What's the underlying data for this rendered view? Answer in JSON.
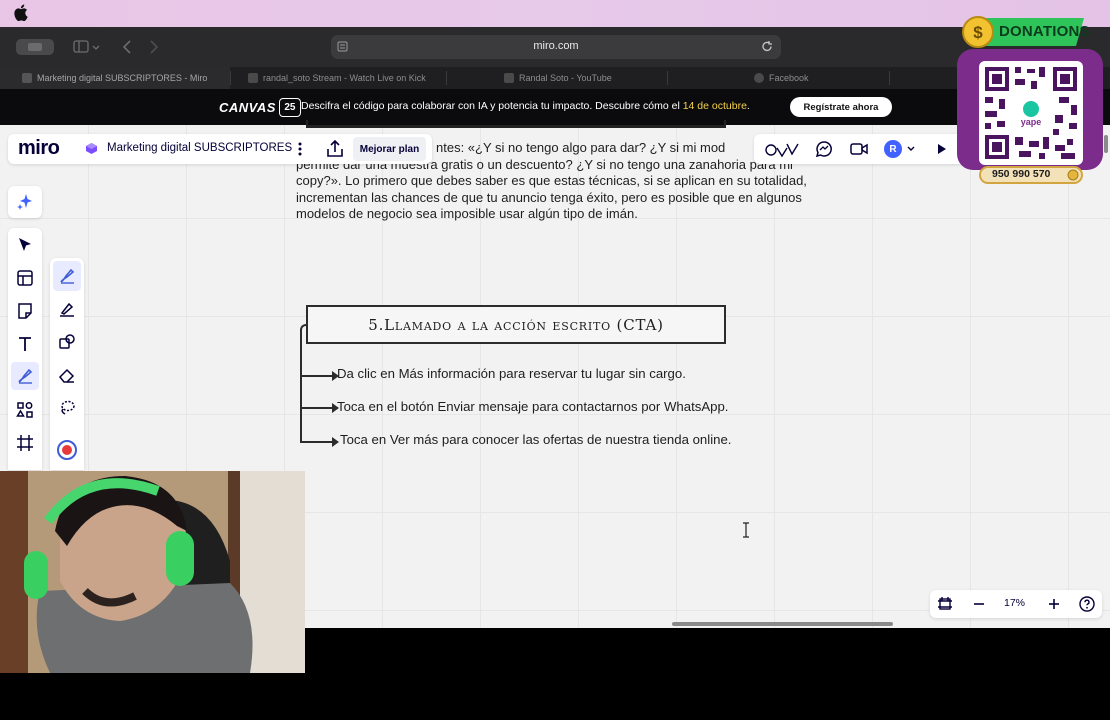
{
  "browser": {
    "url": "miro.com",
    "tabs": [
      {
        "label": "Marketing digital SUBSCRIPTORES - Miro"
      },
      {
        "label": "randal_soto Stream - Watch Live on Kick"
      },
      {
        "label": "Randal Soto - YouTube"
      },
      {
        "label": "Facebook"
      }
    ]
  },
  "banner": {
    "brand": "CANVAS",
    "badge": "25",
    "text_before": "Descifra el código para colaborar con IA y potencia tu impacto. Descubre cómo el ",
    "highlight": "14 de octubre",
    "text_after": ".",
    "cta": "Regístrate ahora"
  },
  "miro": {
    "logo": "miro",
    "board_name": "Marketing digital SUBSCRIPTORES",
    "upgrade_label": "Mejorar plan",
    "avatar_initial": "R",
    "zoom": "17%"
  },
  "board": {
    "paragraph_lines": [
      "ntes: «¿Y si no tengo algo para dar? ¿Y si mi mod",
      "permite dar una muestra gratis o un descuento? ¿Y si no tengo una zanahoria para mi",
      "copy?». Lo primero que debes saber es que estas técnicas, si se aplican en su totalidad,",
      "incrementan las chances de que tu anuncio tenga éxito, pero es posible que en algunos",
      "modelos de negocio sea imposible usar algún tipo de imán."
    ],
    "heading": "5.Llamado a la acción escrito (CTA)",
    "cta_items": [
      "Da clic en Más información para reservar tu lugar sin cargo.",
      "Toca en el botón Enviar mensaje para contactarnos por WhatsApp.",
      "Toca en Ver más para conocer las ofertas de nuestra tienda online."
    ]
  },
  "overlay": {
    "donations_label": "DONATIONS",
    "phone": "950 990 570"
  },
  "colors": {
    "accent": "#4262ff",
    "board_bg": "#f2f2f2",
    "donation_green": "#2fc45a",
    "qr_purple": "#7c2c8a"
  }
}
